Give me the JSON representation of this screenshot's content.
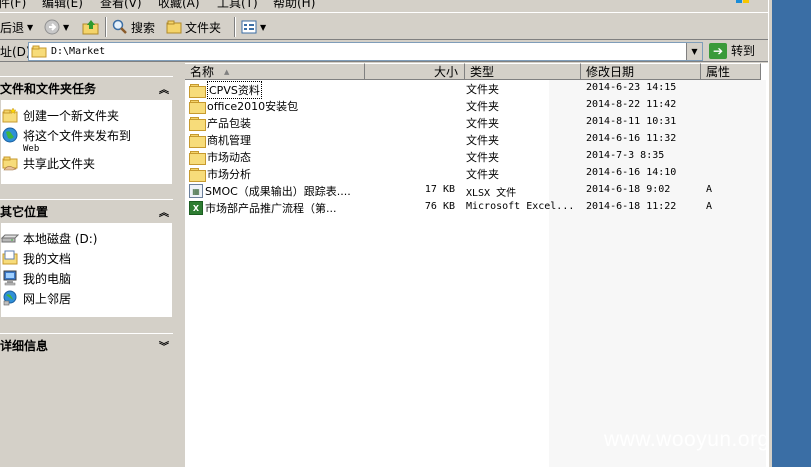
{
  "menubar": {
    "items": [
      "件(F)",
      "编辑(E)",
      "查看(V)",
      "收藏(A)",
      "工具(T)",
      "帮助(H)"
    ]
  },
  "toolbar": {
    "back_label": "后退",
    "search_label": "搜索",
    "folders_label": "文件夹"
  },
  "address": {
    "label": "址(D)",
    "value": "D:\\Market",
    "go_label": "转到"
  },
  "tasks_panel": {
    "title": "文件和文件夹任务",
    "items": [
      {
        "label": "创建一个新文件夹",
        "icon": "new-folder-icon"
      },
      {
        "label": "将这个文件夹发布到",
        "sub": "Web",
        "icon": "publish-web-icon"
      },
      {
        "label": "共享此文件夹",
        "icon": "share-folder-icon"
      }
    ]
  },
  "places_panel": {
    "title": "其它位置",
    "items": [
      {
        "label": "本地磁盘 (D:)",
        "icon": "drive-icon"
      },
      {
        "label": "我的文档",
        "icon": "my-documents-icon"
      },
      {
        "label": "我的电脑",
        "icon": "my-computer-icon"
      },
      {
        "label": "网上邻居",
        "icon": "network-icon"
      }
    ]
  },
  "details_panel": {
    "title": "详细信息"
  },
  "columns": {
    "name": "名称",
    "size": "大小",
    "type": "类型",
    "modified": "修改日期",
    "attr": "属性"
  },
  "files": [
    {
      "name": "CPVS资料",
      "size": "",
      "type": "文件夹",
      "modified": "2014-6-23 14:15",
      "attr": "",
      "icon": "folder-icon"
    },
    {
      "name": "office2010安装包",
      "size": "",
      "type": "文件夹",
      "modified": "2014-8-22 11:42",
      "attr": "",
      "icon": "folder-icon"
    },
    {
      "name": "产品包装",
      "size": "",
      "type": "文件夹",
      "modified": "2014-8-11 10:31",
      "attr": "",
      "icon": "folder-icon"
    },
    {
      "name": "商机管理",
      "size": "",
      "type": "文件夹",
      "modified": "2014-6-16 11:32",
      "attr": "",
      "icon": "folder-icon"
    },
    {
      "name": "市场动态",
      "size": "",
      "type": "文件夹",
      "modified": "2014-7-3 8:35",
      "attr": "",
      "icon": "folder-icon"
    },
    {
      "name": "市场分析",
      "size": "",
      "type": "文件夹",
      "modified": "2014-6-16 14:10",
      "attr": "",
      "icon": "folder-icon"
    },
    {
      "name": "SMOC（成果输出）跟踪表....",
      "size": "17 KB",
      "type": "XLSX 文件",
      "modified": "2014-6-18 9:02",
      "attr": "A",
      "icon": "xlsx-file-icon"
    },
    {
      "name": "市场部产品推广流程（第...",
      "size": "76 KB",
      "type": "Microsoft Excel...",
      "modified": "2014-6-18 11:22",
      "attr": "A",
      "icon": "excel-file-icon"
    }
  ],
  "watermark": "www.wooyun.org"
}
